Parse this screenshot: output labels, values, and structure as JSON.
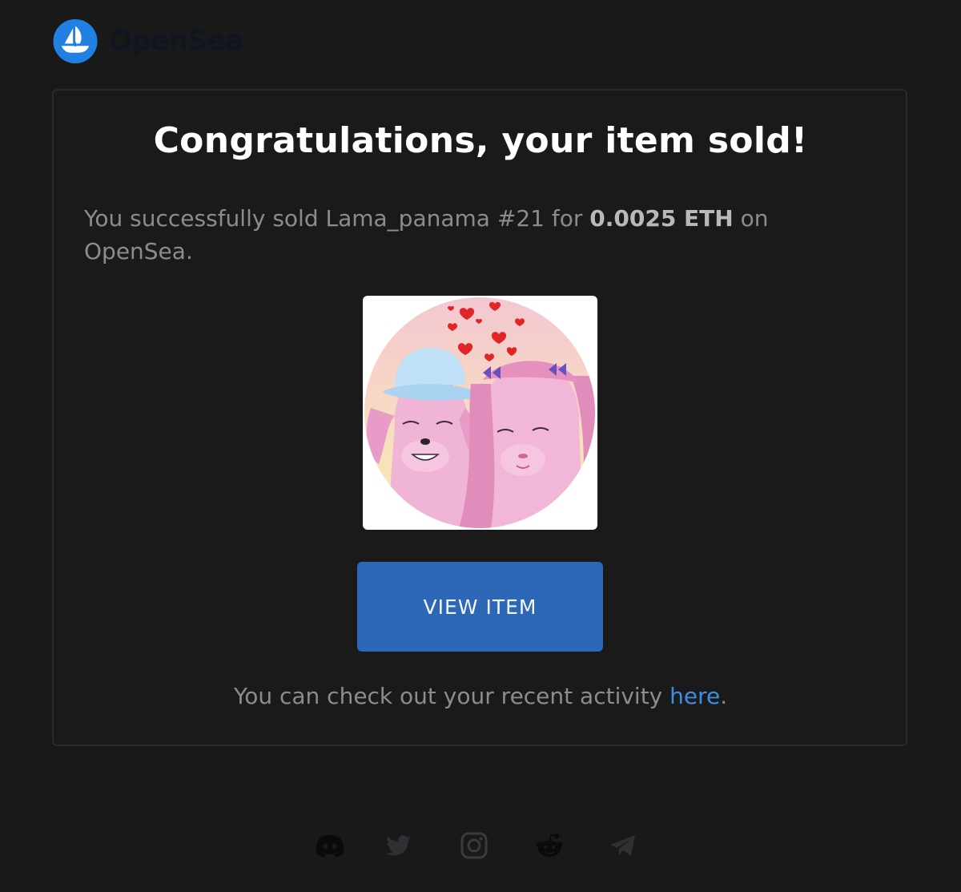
{
  "brand": {
    "name": "OpenSea",
    "logo_icon": "opensea-ship-icon",
    "accent": "#2081e2"
  },
  "card": {
    "title": "Congratulations, your item sold!",
    "message": {
      "prefix": "You successfully sold Lama_panama #21 for ",
      "amount": "0.0025 ETH",
      "suffix": " on OpenSea."
    },
    "item_image_alt": "Lama_panama #21",
    "view_button_label": "VIEW ITEM",
    "activity": {
      "prefix": "You can check out your recent activity ",
      "link": "here",
      "suffix": "."
    }
  },
  "social": [
    {
      "name": "discord",
      "icon": "discord-icon"
    },
    {
      "name": "twitter",
      "icon": "twitter-icon"
    },
    {
      "name": "instagram",
      "icon": "instagram-icon"
    },
    {
      "name": "reddit",
      "icon": "reddit-icon"
    },
    {
      "name": "telegram",
      "icon": "telegram-icon"
    }
  ],
  "colors": {
    "background": "#19191a",
    "button": "#2d67b8",
    "link": "#3f8fe0"
  }
}
